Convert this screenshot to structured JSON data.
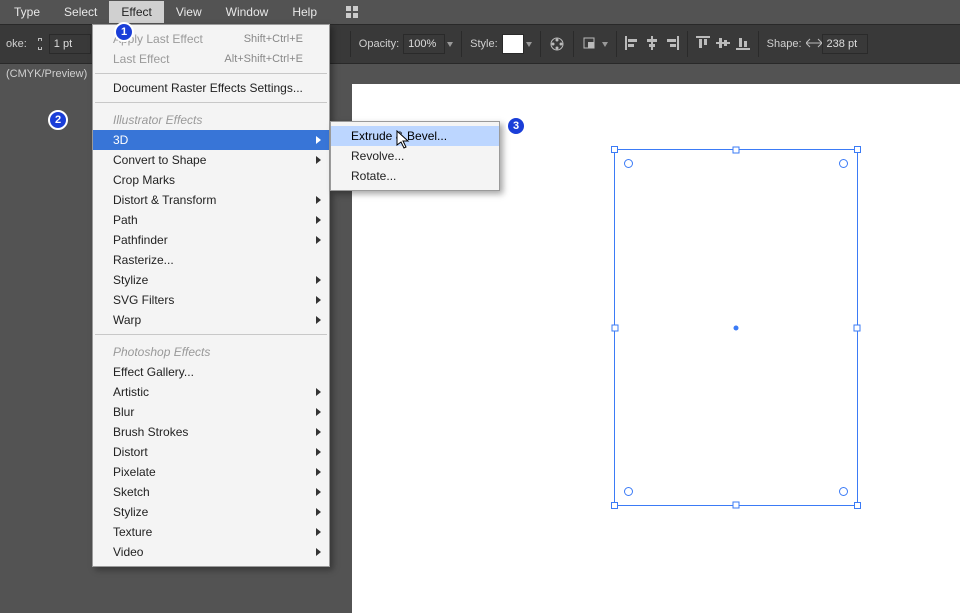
{
  "menubar": {
    "items": [
      "Type",
      "Select",
      "Effect",
      "View",
      "Window",
      "Help"
    ],
    "active_index": 2
  },
  "options": {
    "stroke_label": "oke:",
    "stroke_chain_title": "link",
    "stroke_value": "1 pt",
    "opacity_label": "Opacity:",
    "opacity_value": "100%",
    "style_label": "Style:",
    "shape_label": "Shape:",
    "shape_value": "238 pt"
  },
  "tab": {
    "label": "(CMYK/Preview)"
  },
  "effect_menu": {
    "apply_last": "Apply Last Effect",
    "apply_last_shortcut": "Shift+Ctrl+E",
    "last": "Last Effect",
    "last_shortcut": "Alt+Shift+Ctrl+E",
    "raster_settings": "Document Raster Effects Settings...",
    "section_illustrator": "Illustrator Effects",
    "items_illustrator": [
      {
        "label": "3D",
        "submenu": true,
        "selected": true
      },
      {
        "label": "Convert to Shape",
        "submenu": true
      },
      {
        "label": "Crop Marks"
      },
      {
        "label": "Distort & Transform",
        "submenu": true
      },
      {
        "label": "Path",
        "submenu": true
      },
      {
        "label": "Pathfinder",
        "submenu": true
      },
      {
        "label": "Rasterize..."
      },
      {
        "label": "Stylize",
        "submenu": true
      },
      {
        "label": "SVG Filters",
        "submenu": true
      },
      {
        "label": "Warp",
        "submenu": true
      }
    ],
    "section_photoshop": "Photoshop Effects",
    "items_photoshop": [
      {
        "label": "Effect Gallery..."
      },
      {
        "label": "Artistic",
        "submenu": true
      },
      {
        "label": "Blur",
        "submenu": true
      },
      {
        "label": "Brush Strokes",
        "submenu": true
      },
      {
        "label": "Distort",
        "submenu": true
      },
      {
        "label": "Pixelate",
        "submenu": true
      },
      {
        "label": "Sketch",
        "submenu": true
      },
      {
        "label": "Stylize",
        "submenu": true
      },
      {
        "label": "Texture",
        "submenu": true
      },
      {
        "label": "Video",
        "submenu": true
      }
    ]
  },
  "submenu_3d": {
    "items": [
      {
        "label": "Extrude & Bevel...",
        "highlight": true
      },
      {
        "label": "Revolve..."
      },
      {
        "label": "Rotate..."
      }
    ]
  },
  "annotations": {
    "a1": "1",
    "a2": "2",
    "a3": "3"
  }
}
